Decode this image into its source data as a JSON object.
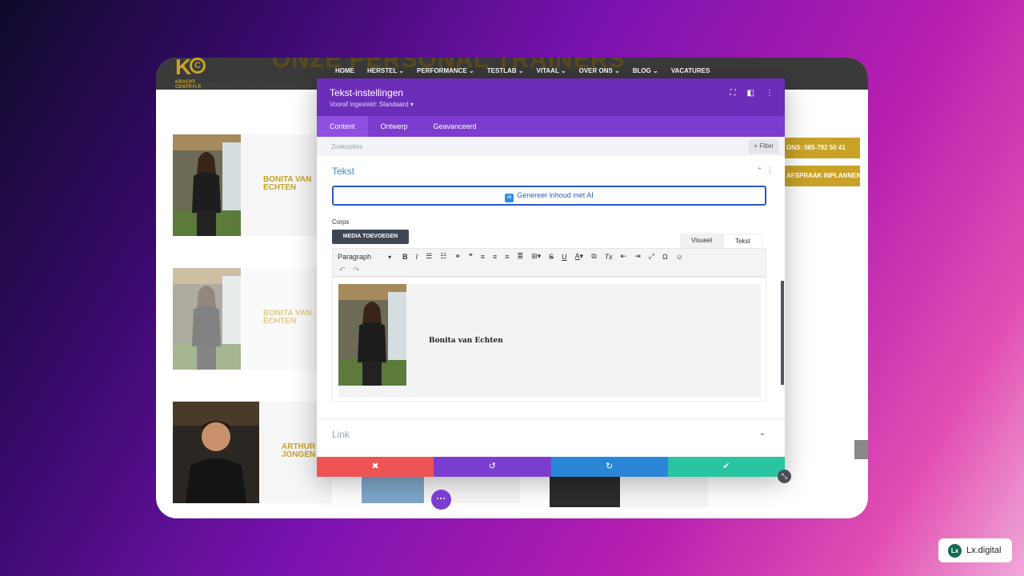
{
  "site": {
    "logo": {
      "letter": "K",
      "circle": "C",
      "line1": "KRACHT",
      "line2": "CENTRALE"
    },
    "ghost_title": "ONZE PERSONAL TRAINERS",
    "ghost_sub": "...ur, Matthias of Niels verzorgen we...",
    "nav": [
      "HOME",
      "HERSTEL ⌄",
      "PERFORMANCE ⌄",
      "TESTLAB ⌄",
      "VITAAL ⌄",
      "OVER ONS ⌄",
      "BLOG ⌄",
      "VACATURES"
    ],
    "cards": [
      {
        "line1": "BONITA VAN",
        "line2": "ECHTEN"
      },
      {
        "line1": "BONITA VAN",
        "line2": "ECHTEN"
      },
      {
        "line1": "ARTHUR",
        "line2": "JONGEN"
      }
    ],
    "cta_phone": "ONS: 085-792 50 41",
    "cta_appointment": "AFSPRAAK INPLANNEN"
  },
  "modal": {
    "title": "Tekst-instellingen",
    "preset": "Vooraf ingesteld: Standaard ▾",
    "tabs": [
      "Content",
      "Ontwerp",
      "Geavanceerd"
    ],
    "search_placeholder": "Zoekopties",
    "filter_label": "+ Filter",
    "section_title": "Tekst",
    "ai_badge": "AI",
    "ai_button": "Genereer inhoud met AI",
    "corps_label": "Corps",
    "media_button": "MEDIA TOEVOEGEN",
    "mode_visual": "Visueel",
    "mode_text": "Tekst",
    "paragraph_select": "Paragraph",
    "editor_name": "Bonita van Echten",
    "link_title": "Link"
  },
  "brand": {
    "mark": "Lx",
    "name": "Lx.digital"
  },
  "colors": {
    "purple": "#6c2eb9",
    "gold": "#c9a227",
    "cancel": "#ef5455",
    "undo": "#7b3dcf",
    "redo": "#2b86d7",
    "save": "#29c4a0"
  }
}
